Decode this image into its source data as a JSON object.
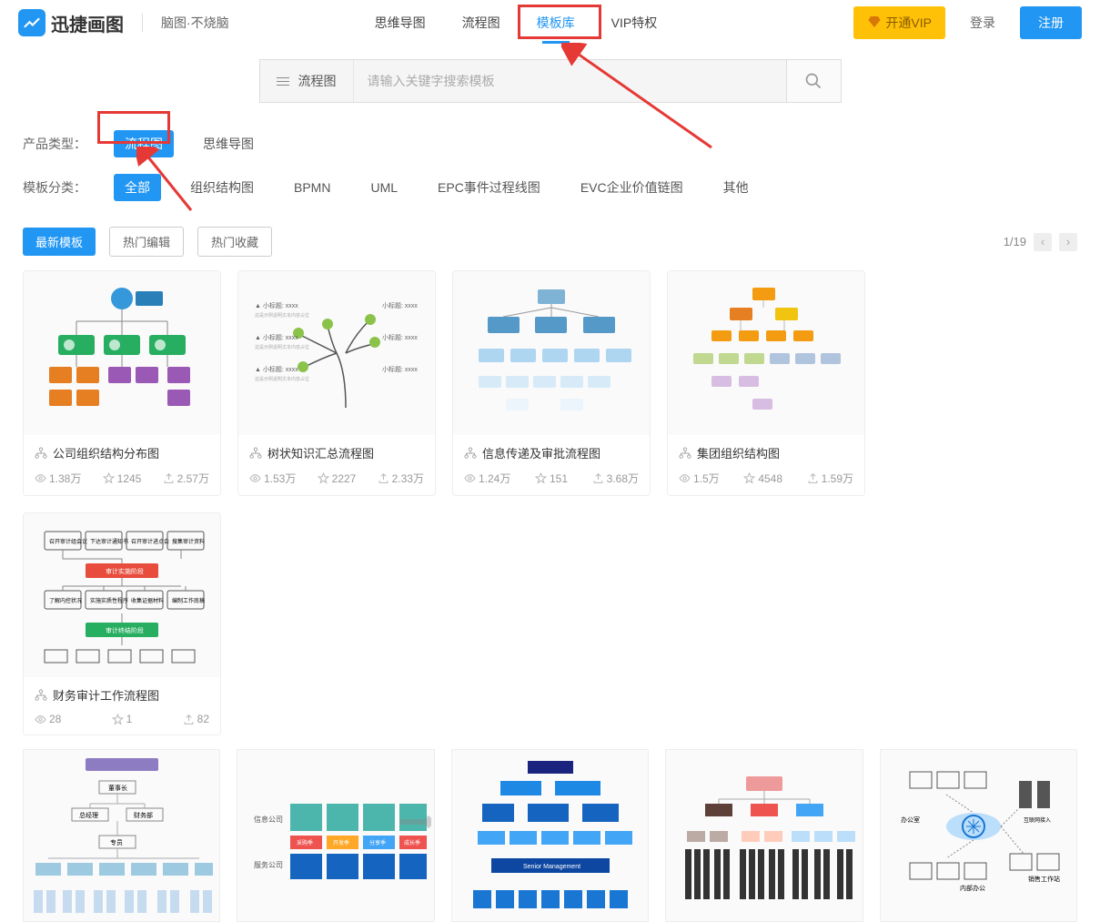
{
  "brand": {
    "logo_text": "迅捷画图",
    "slogan": "脑图·不烧脑"
  },
  "nav": {
    "items": [
      "思维导图",
      "流程图",
      "模板库",
      "VIP特权"
    ],
    "active_index": 2
  },
  "header_actions": {
    "vip": "开通VIP",
    "login": "登录",
    "register": "注册"
  },
  "search": {
    "category": "流程图",
    "placeholder": "请输入关键字搜索模板"
  },
  "filters": {
    "product_type": {
      "label": "产品类型：",
      "options": [
        "流程图",
        "思维导图"
      ],
      "active_index": 0
    },
    "template_category": {
      "label": "模板分类：",
      "options": [
        "全部",
        "组织结构图",
        "BPMN",
        "UML",
        "EPC事件过程线图",
        "EVC企业价值链图",
        "其他"
      ],
      "active_index": 0
    }
  },
  "sort": {
    "options": [
      "最新模板",
      "热门编辑",
      "热门收藏"
    ],
    "active_index": 0
  },
  "pagination": {
    "current": 1,
    "total": 19,
    "display": "1/19"
  },
  "templates": [
    {
      "title": "公司组织结构分布图",
      "views": "1.38万",
      "stars": "1245",
      "exports": "2.57万"
    },
    {
      "title": "树状知识汇总流程图",
      "views": "1.53万",
      "stars": "2227",
      "exports": "2.33万"
    },
    {
      "title": "信息传递及审批流程图",
      "views": "1.24万",
      "stars": "151",
      "exports": "3.68万"
    },
    {
      "title": "集团组织结构图",
      "views": "1.5万",
      "stars": "4548",
      "exports": "1.59万"
    },
    {
      "title": "财务审计工作流程图",
      "views": "28",
      "stars": "1",
      "exports": "82"
    }
  ],
  "annotations": {
    "nav_highlight": "模板库",
    "filter_highlight": "流程图"
  }
}
